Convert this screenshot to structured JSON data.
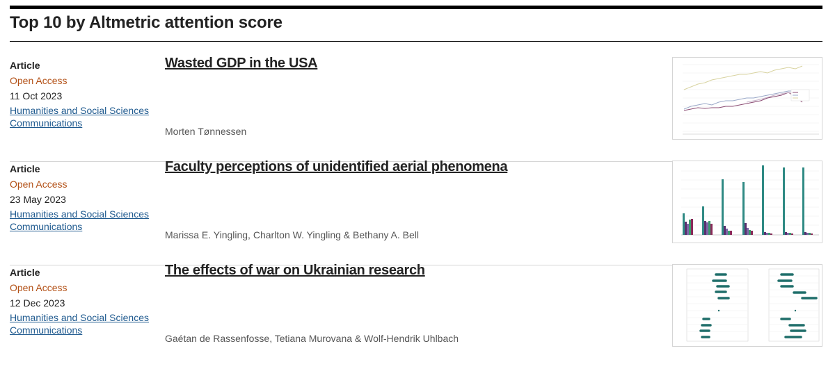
{
  "section": {
    "title": "Top 10 by Altmetric attention score"
  },
  "articles": [
    {
      "type": "Article",
      "access": "Open Access",
      "date": "11 Oct 2023",
      "journal": "Humanities and Social Sciences Communications",
      "title": "Wasted GDP in the USA",
      "authors": "Morten Tønnessen",
      "thumbnail_icon": "line-chart-thumbnail"
    },
    {
      "type": "Article",
      "access": "Open Access",
      "date": "23 May 2023",
      "journal": "Humanities and Social Sciences Communications",
      "title": "Faculty perceptions of unidentified aerial phenomena",
      "authors": "Marissa E. Yingling, Charlton W. Yingling & Bethany A. Bell",
      "thumbnail_icon": "bar-chart-thumbnail"
    },
    {
      "type": "Article",
      "access": "Open Access",
      "date": "12 Dec 2023",
      "journal": "Humanities and Social Sciences Communications",
      "title": "The effects of war on Ukrainian research",
      "authors": "Gaétan de Rassenfosse, Tetiana Murovana & Wolf-Hendrik Uhlbach",
      "thumbnail_icon": "dot-plot-thumbnail"
    }
  ],
  "colors": {
    "open_access": "#b24f14",
    "link": "#1f5a8f",
    "text": "#222222"
  }
}
